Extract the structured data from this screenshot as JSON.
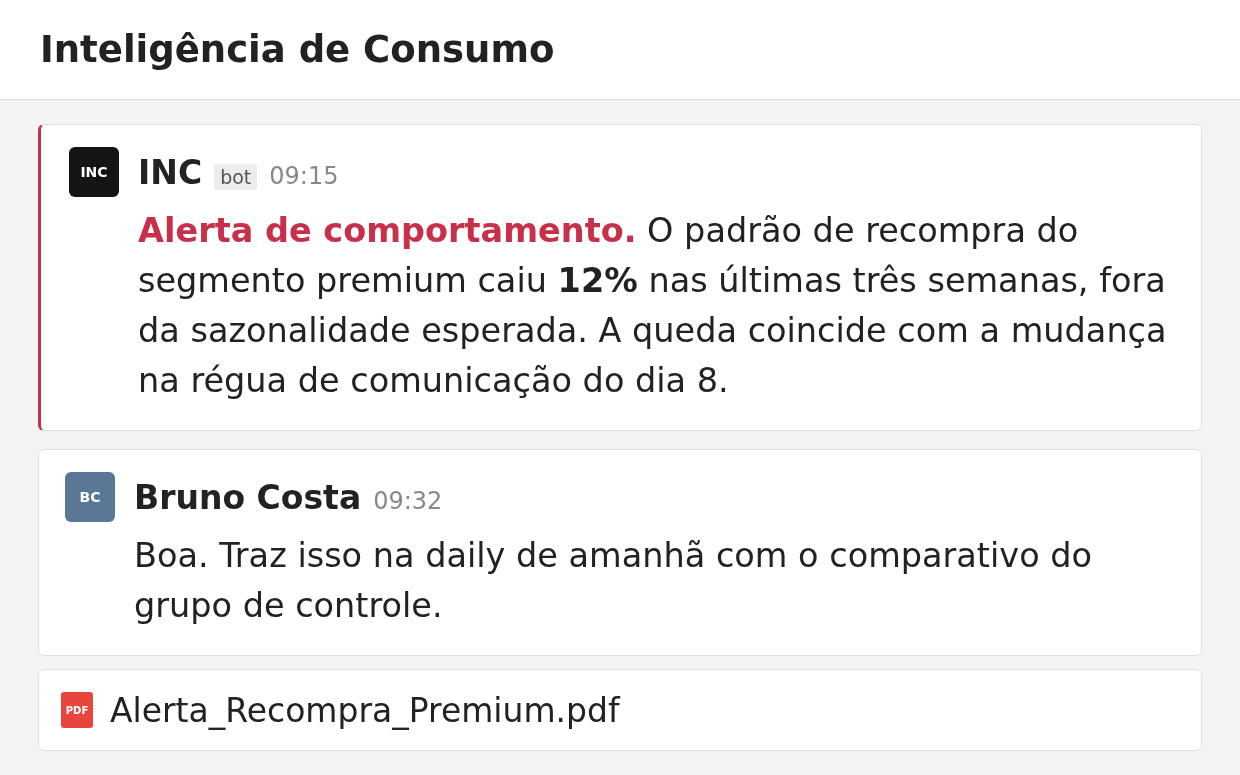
{
  "channel": {
    "title": "Inteligência de Consumo"
  },
  "feed": [
    {
      "kind": "alert",
      "avatar": "INC",
      "color": "#141414",
      "author": "INC",
      "badge": "bot",
      "time": "09:15",
      "headline": "Alerta de comportamento.",
      "text": "O padrão de recompra do segmento premium caiu **12%** nas últimas três semanas, fora da sazonalidade esperada. A queda coincide com a mudança na régua de comunicação do dia 8."
    },
    {
      "kind": "message",
      "avatar": "BC",
      "color": "#5a7896",
      "author": "Bruno Costa",
      "time": "09:32",
      "text": "Boa. Traz isso na daily de amanhã com o comparativo do grupo de controle."
    },
    {
      "kind": "file",
      "file_type": "PDF",
      "filename": "Alerta_Recompra_Premium.pdf"
    }
  ]
}
